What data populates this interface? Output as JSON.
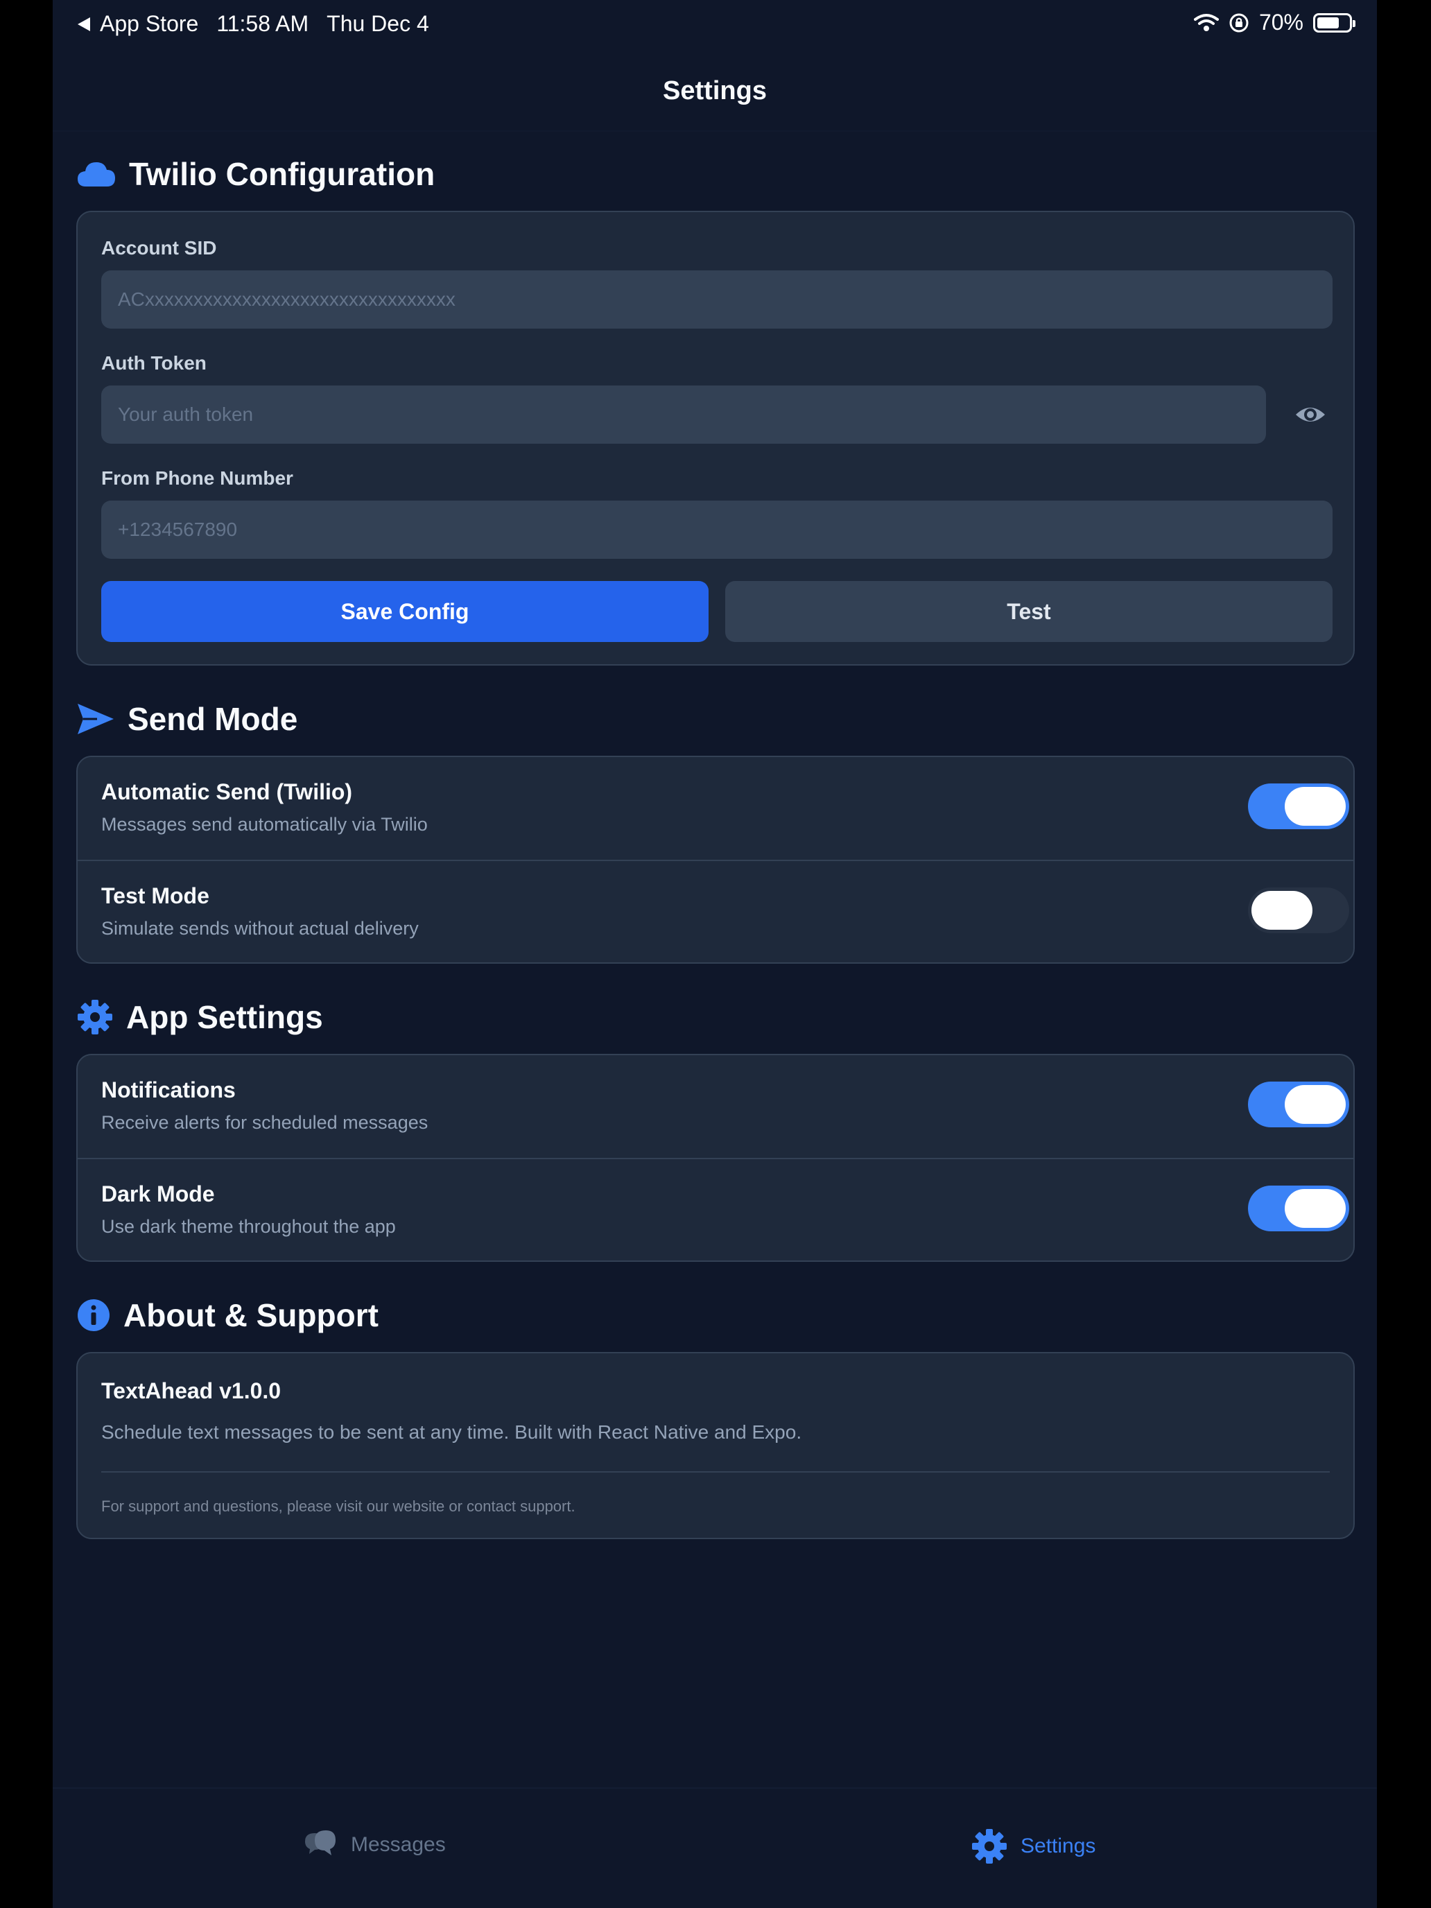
{
  "status_bar": {
    "back_app": "App Store",
    "time": "11:58 AM",
    "date": "Thu Dec 4",
    "battery": "70%"
  },
  "header": {
    "title": "Settings"
  },
  "twilio": {
    "heading": "Twilio Configuration",
    "account_sid_label": "Account SID",
    "account_sid_placeholder": "ACxxxxxxxxxxxxxxxxxxxxxxxxxxxxxxxx",
    "auth_token_label": "Auth Token",
    "auth_token_placeholder": "Your auth token",
    "from_phone_label": "From Phone Number",
    "from_phone_placeholder": "+1234567890",
    "save_label": "Save Config",
    "test_label": "Test"
  },
  "send_mode": {
    "heading": "Send Mode",
    "items": [
      {
        "title": "Automatic Send (Twilio)",
        "subtitle": "Messages send automatically via Twilio",
        "enabled": true
      },
      {
        "title": "Test Mode",
        "subtitle": "Simulate sends without actual delivery",
        "enabled": false
      }
    ]
  },
  "app_settings": {
    "heading": "App Settings",
    "items": [
      {
        "title": "Notifications",
        "subtitle": "Receive alerts for scheduled messages",
        "enabled": true
      },
      {
        "title": "Dark Mode",
        "subtitle": "Use dark theme throughout the app",
        "enabled": true
      }
    ]
  },
  "about": {
    "heading": "About & Support",
    "app_name": "TextAhead v1.0.0",
    "description": "Schedule text messages to be sent at any time. Built with React Native and Expo.",
    "footer": "For support and questions, please visit our website or contact support."
  },
  "tabbar": {
    "messages_label": "Messages",
    "settings_label": "Settings",
    "active": "settings"
  },
  "colors": {
    "background": "#0f172a",
    "card": "#1e293b",
    "input": "#334155",
    "accent": "#3b82f6",
    "primary_button": "#2563eb"
  }
}
